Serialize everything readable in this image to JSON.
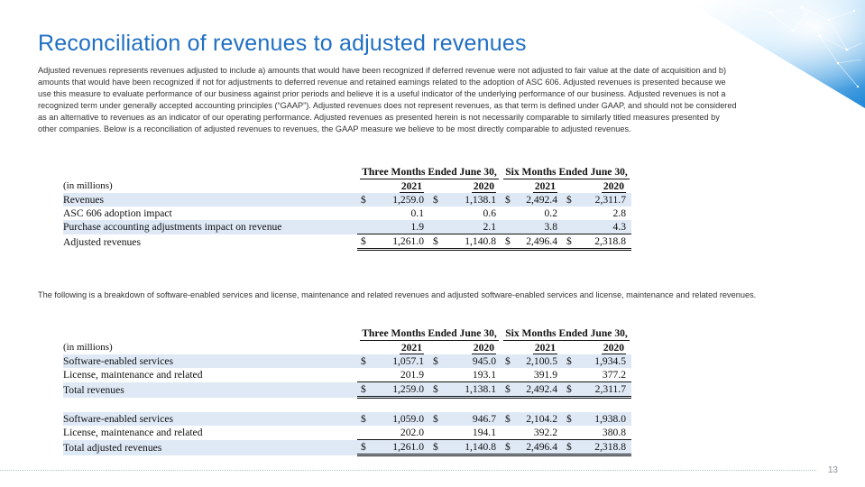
{
  "title": "Reconciliation of revenues to adjusted revenues",
  "intro": "Adjusted revenues represents revenues adjusted to include a) amounts that would have been recognized if deferred revenue were not adjusted to fair value at the date of acquisition and b) amounts that would have been recognized if not for adjustments to deferred revenue and retained earnings related to the adoption of ASC 606.  Adjusted revenues is presented because we use this measure to evaluate performance of our business against prior periods and believe it is a useful indicator of the underlying performance of our business.  Adjusted revenues is not a recognized term under generally accepted accounting principles (“GAAP”).  Adjusted revenues does not represent revenues, as that term is defined under GAAP, and should not be considered as an alternative to revenues as an indicator of our operating performance.  Adjusted revenues as presented herein is not necessarily comparable to similarly titled measures presented by other companies.  Below is a reconciliation of adjusted revenues to revenues, the GAAP measure we believe to be most directly comparable to adjusted revenues.",
  "breakdown_text": "The following is a breakdown of software-enabled services and license, maintenance and related revenues and adjusted software-enabled services and license, maintenance and related revenues.",
  "page_number": "13",
  "table1": {
    "group_headers": [
      "Three Months Ended June 30,",
      "Six Months Ended June 30,"
    ],
    "units": "(in millions)",
    "years": [
      "2021",
      "2020",
      "2021",
      "2020"
    ],
    "rows": [
      {
        "label": "Revenues",
        "dollar": "$",
        "values": [
          "1,259.0",
          "1,138.1",
          "2,492.4",
          "2,311.7"
        ]
      },
      {
        "label": "ASC 606 adoption impact",
        "dollar": "",
        "values": [
          "0.1",
          "0.6",
          "0.2",
          "2.8"
        ]
      },
      {
        "label": "Purchase accounting adjustments impact on revenue",
        "dollar": "",
        "values": [
          "1.9",
          "2.1",
          "3.8",
          "4.3"
        ]
      },
      {
        "label": "Adjusted revenues",
        "dollar": "$",
        "values": [
          "1,261.0",
          "1,140.8",
          "2,496.4",
          "2,318.8"
        ]
      }
    ]
  },
  "table2": {
    "group_headers": [
      "Three Months Ended June 30,",
      "Six Months Ended June 30,"
    ],
    "units": "(in millions)",
    "years": [
      "2021",
      "2020",
      "2021",
      "2020"
    ],
    "rows": [
      {
        "label": "Software-enabled services",
        "dollar": "$",
        "values": [
          "1,057.1",
          "945.0",
          "2,100.5",
          "1,934.5"
        ]
      },
      {
        "label": "License, maintenance and related",
        "dollar": "",
        "values": [
          "201.9",
          "193.1",
          "391.9",
          "377.2"
        ]
      },
      {
        "label": "Total revenues",
        "dollar": "$",
        "values": [
          "1,259.0",
          "1,138.1",
          "2,492.4",
          "2,311.7"
        ]
      },
      {
        "label": "Software-enabled services",
        "dollar": "$",
        "values": [
          "1,059.0",
          "946.7",
          "2,104.2",
          "1,938.0"
        ]
      },
      {
        "label": "License, maintenance and related",
        "dollar": "",
        "values": [
          "202.0",
          "194.1",
          "392.2",
          "380.8"
        ]
      },
      {
        "label": "Total adjusted revenues",
        "dollar": "$",
        "values": [
          "1,261.0",
          "1,140.8",
          "2,496.4",
          "2,318.8"
        ]
      }
    ]
  },
  "colors": {
    "title": "#1f6fc2",
    "row_shading": "#dfe9f6",
    "graphic_blue": "#2b8fd8"
  },
  "icons": {
    "corner_graphic": "network-globe-graphic"
  }
}
